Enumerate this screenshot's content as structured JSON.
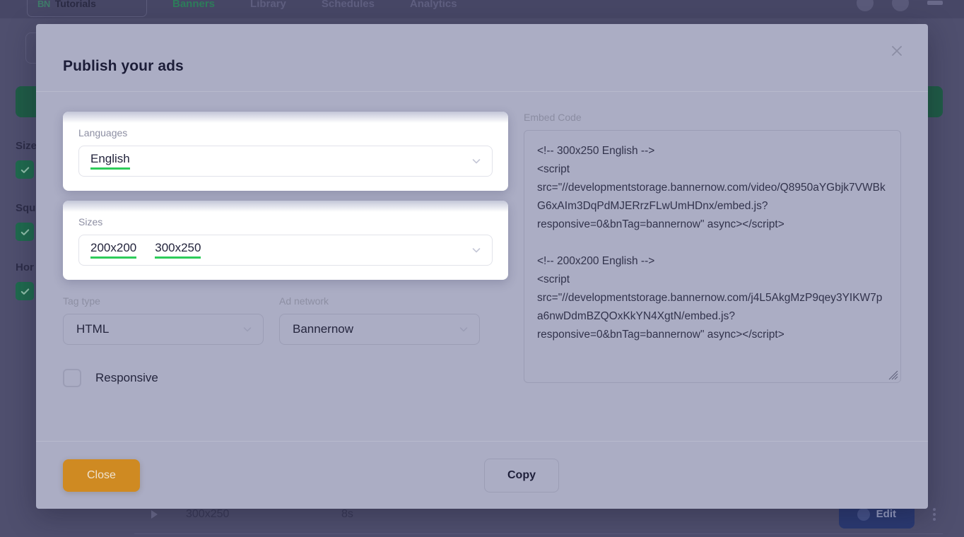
{
  "background": {
    "logo_mark": "BN",
    "logo_text": "Tutorials",
    "tabs": [
      {
        "label": "Banners",
        "active": true
      },
      {
        "label": "Library",
        "active": false
      },
      {
        "label": "Schedules",
        "active": false
      },
      {
        "label": "Analytics",
        "active": false
      }
    ],
    "back_arrow": "‹",
    "filters": [
      {
        "label": "Size",
        "checked": true
      },
      {
        "label": "Squ",
        "checked": true
      },
      {
        "label": "Hor",
        "checked": true
      }
    ],
    "row": {
      "size": "300x250",
      "duration": "8s",
      "edit_label": "Edit"
    }
  },
  "modal": {
    "title": "Publish your ads",
    "close_icon": "close-icon",
    "languages": {
      "label": "Languages",
      "values": [
        "English"
      ]
    },
    "sizes": {
      "label": "Sizes",
      "values": [
        "200x200",
        "300x250"
      ]
    },
    "tag_type": {
      "label": "Tag type",
      "value": "HTML"
    },
    "ad_network": {
      "label": "Ad network",
      "value": "Bannernow"
    },
    "responsive": {
      "label": "Responsive",
      "checked": false
    },
    "embed": {
      "label": "Embed Code",
      "code": "<!-- 300x250 English -->\n<script src=\"//developmentstorage.bannernow.com/video/Q8950aYGbjk7VWBkG6xAIm3DqPdMJERrzFLwUmHDnx/embed.js?responsive=0&bnTag=bannernow\" async></script>\n\n<!-- 200x200 English -->\n<script src=\"//developmentstorage.bannernow.com/j4L5AkgMzP9qey3YIKW7pa6nwDdmBZQOxKkYN4XgtN/embed.js?responsive=0&bnTag=bannernow\" async></script>"
    },
    "footer": {
      "close_label": "Close",
      "copy_label": "Copy"
    }
  },
  "colors": {
    "accent_green": "#2ecc5a",
    "close_button": "#cf8a22",
    "modal_bg": "#abadc4",
    "backdrop": "#4f4f6e",
    "brand_green": "#2e7d5b"
  }
}
